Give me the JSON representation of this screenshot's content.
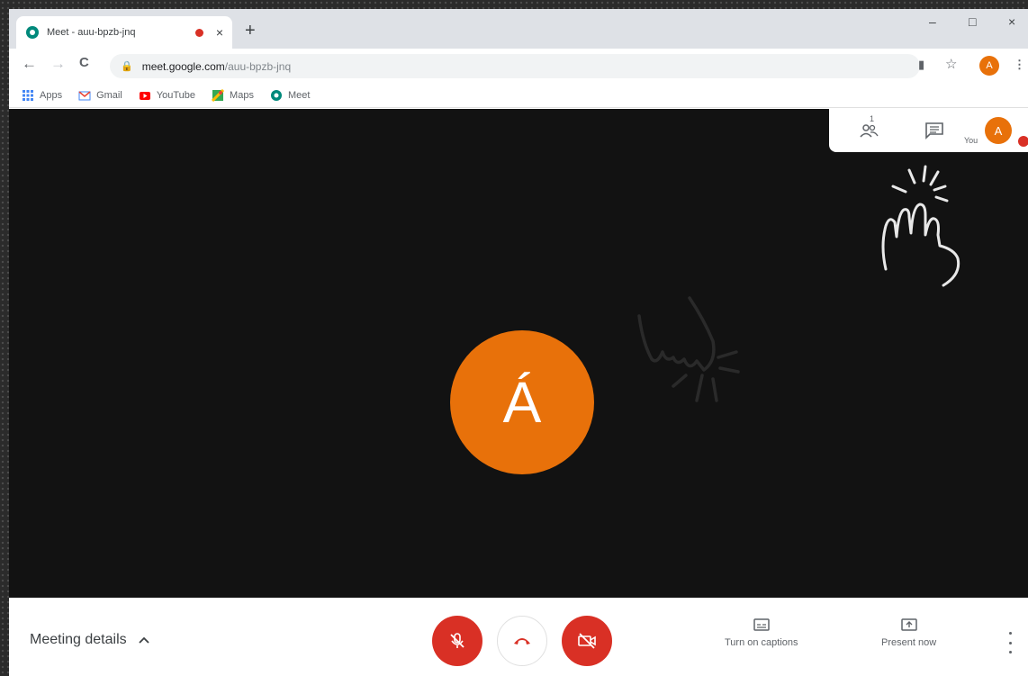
{
  "browser": {
    "tab": {
      "title": "Meet - auu-bpzb-jnq",
      "close": "×"
    },
    "new_tab": "+",
    "window_controls": {
      "minimize": "–",
      "maximize": "□",
      "close": "×"
    },
    "nav": {
      "back": "←",
      "forward": "→",
      "reload": "C"
    },
    "url": {
      "host": "meet.google.com",
      "path": "/auu-bpzb-jnq"
    },
    "profile_initial": "A",
    "bookmarks": [
      {
        "label": "Apps",
        "icon": "apps-grid-icon"
      },
      {
        "label": "Gmail",
        "icon": "gmail-icon"
      },
      {
        "label": "YouTube",
        "icon": "youtube-icon"
      },
      {
        "label": "Maps",
        "icon": "maps-icon"
      },
      {
        "label": "Meet",
        "icon": "meet-icon"
      }
    ]
  },
  "meet": {
    "participant_initial": "A",
    "participant_initial_accent": "Á",
    "top_panel": {
      "people_count": "1",
      "you_label": "You",
      "avatar_initial": "A"
    },
    "bottom_bar": {
      "meeting_details": "Meeting details",
      "captions_label": "Turn on captions",
      "present_label": "Present now"
    },
    "colors": {
      "avatar": "#e8710a",
      "danger": "#d93025",
      "stage": "#121212"
    }
  }
}
